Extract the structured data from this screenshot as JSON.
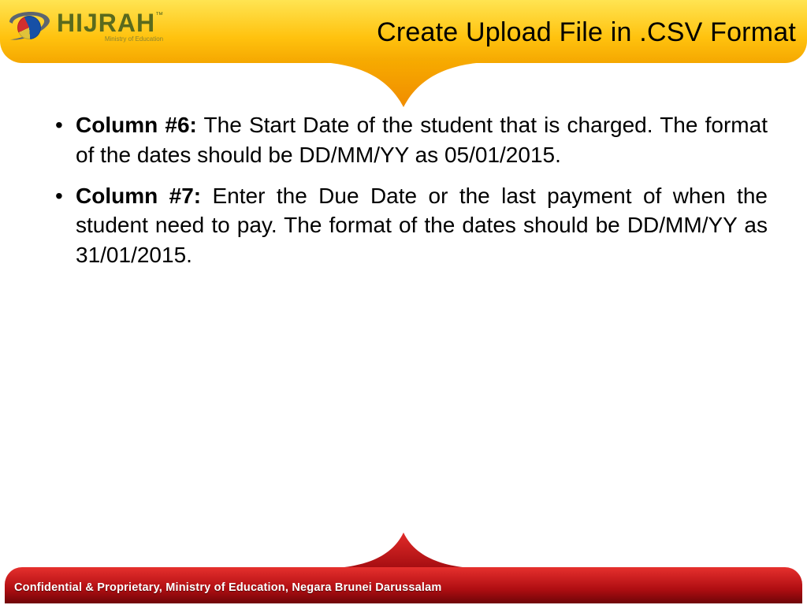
{
  "header": {
    "title": "Create Upload File in .CSV Format",
    "logo_word": "HIJRAH",
    "logo_tm": "™",
    "logo_sub": "Ministry of Education"
  },
  "bullets": [
    {
      "label": "Column #6:",
      "text": " The Start Date of the student that is charged. The format of the dates should be DD/MM/YY as 05/01/2015."
    },
    {
      "label": "Column #7:",
      "text": " Enter the Due Date or the last payment of when the student need to pay. The format of the  dates should be DD/MM/YY as  31/01/2015."
    }
  ],
  "footer": {
    "text": "Confidential & Proprietary, Ministry of Education, Negara Brunei Darussalam"
  }
}
